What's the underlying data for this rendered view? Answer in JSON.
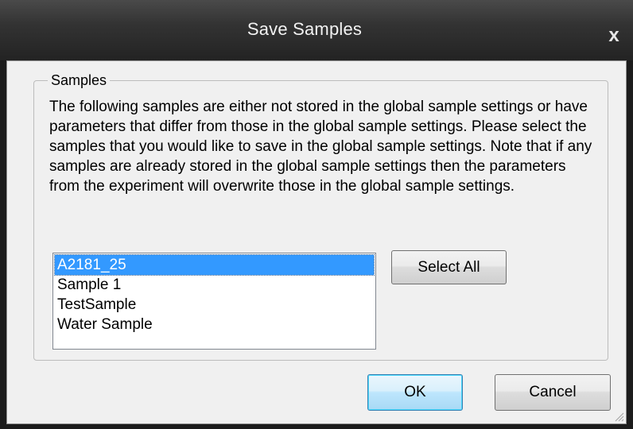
{
  "window": {
    "title": "Save Samples",
    "close_glyph": "x"
  },
  "samples_group": {
    "legend": "Samples",
    "description": "The following samples are either not stored in the global sample settings or have parameters that differ from those in the global sample settings. Please select the samples that you would like to save in the global sample settings. Note that if any samples are already stored in the global sample settings then the parameters from the experiment will overwrite those in the global sample settings.",
    "list": {
      "items": [
        "A2181_25",
        "Sample 1",
        "TestSample",
        "Water Sample"
      ],
      "selected": "A2181_25"
    },
    "select_all_label": "Select All"
  },
  "footer": {
    "ok_label": "OK",
    "cancel_label": "Cancel"
  },
  "colors": {
    "titlebar": "#2b2b2b",
    "dialog_bg": "#f0f0f0",
    "selection": "#3399ff"
  }
}
